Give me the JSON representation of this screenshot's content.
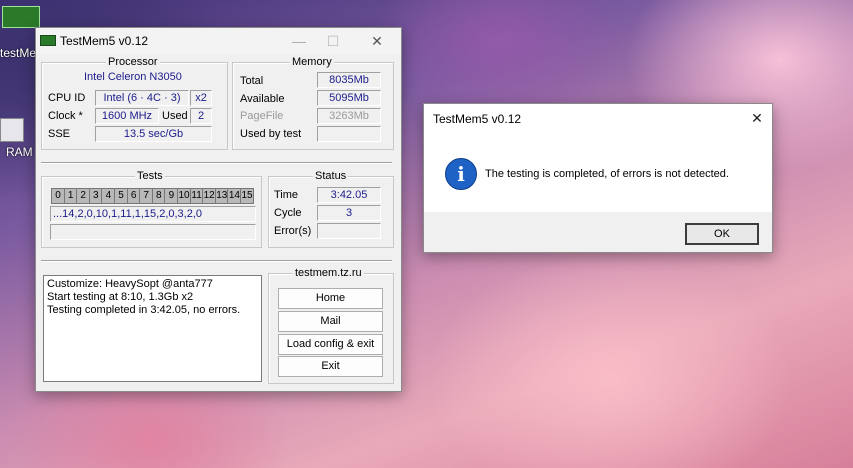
{
  "desktop": {
    "icon1_label": "testMem",
    "icon2_label": "RAM"
  },
  "main_window": {
    "title": "TestMem5 v0.12",
    "minimize_glyph": "—",
    "maximize_glyph": "☐",
    "close_glyph": "✕",
    "processor": {
      "title": "Processor",
      "name": "Intel Celeron  N3050",
      "cpu_id_label": "CPU ID",
      "cpu_id_value": "Intel  (6 · 4C · 3)",
      "cpu_id_mult": "x2",
      "clock_label": "Clock *",
      "clock_value": "1600 MHz",
      "used_label": "Used",
      "used_value": "2",
      "sse_label": "SSE",
      "sse_value": "13.5 sec/Gb"
    },
    "memory": {
      "title": "Memory",
      "total_label": "Total",
      "total_value": "8035Mb",
      "available_label": "Available",
      "available_value": "5095Mb",
      "pagefile_label": "PageFile",
      "pagefile_value": "3263Mb",
      "used_by_test_label": "Used by test",
      "used_by_test_value": ""
    },
    "tests": {
      "title": "Tests",
      "cells": [
        "0",
        "1",
        "2",
        "3",
        "4",
        "5",
        "6",
        "7",
        "8",
        "9",
        "10",
        "11",
        "12",
        "13",
        "14",
        "15"
      ],
      "sequence": "...14,2,0,10,1,11,1,15,2,0,3,2,0",
      "progress": ""
    },
    "status": {
      "title": "Status",
      "time_label": "Time",
      "time_value": "3:42.05",
      "cycle_label": "Cycle",
      "cycle_value": "3",
      "errors_label": "Error(s)",
      "errors_value": ""
    },
    "log": {
      "lines": [
        "Customize: HeavySopt @anta777",
        "Start testing at 8:10, 1.3Gb x2",
        "Testing completed in 3:42.05, no errors."
      ]
    },
    "links": {
      "title": "testmem.tz.ru",
      "home": "Home",
      "mail": "Mail",
      "load_config": "Load config & exit",
      "exit": "Exit"
    }
  },
  "dialog": {
    "title": "TestMem5 v0.12",
    "close_glyph": "✕",
    "info_glyph": "i",
    "message": "The testing is completed, of errors is not detected.",
    "ok": "OK"
  },
  "colors": {
    "field_text": "#1c1c8c",
    "info_icon": "#1f62c6"
  }
}
